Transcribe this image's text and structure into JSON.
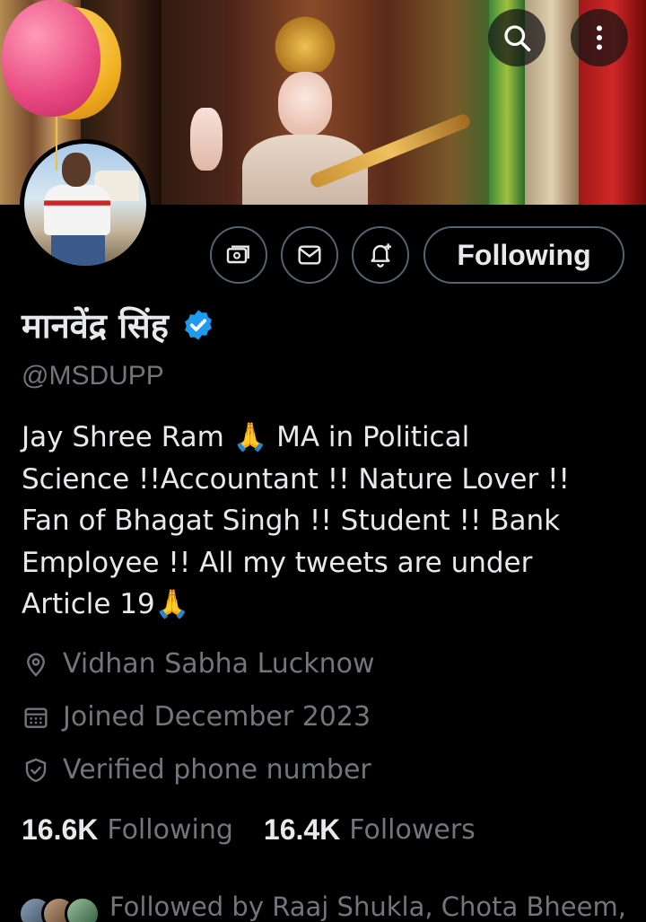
{
  "profile": {
    "name": "मानवेंद्र सिंह",
    "handle": "@MSDUPP",
    "bio": "Jay Shree Ram 🙏 MA in Political\nScience !!Accountant !! Nature Lover !!\nFan of Bhagat Singh !! Student !! Bank\nEmployee !! All my tweets are under\nArticle 19🙏",
    "location": "Vidhan Sabha Lucknow",
    "joined": "Joined December 2023",
    "verification": "Verified phone number"
  },
  "actions": {
    "follow_label": "Following"
  },
  "stats": {
    "following_count": "16.6K",
    "following_label": "Following",
    "followers_count": "16.4K",
    "followers_label": "Followers"
  },
  "followed_by": {
    "text": "Followed by Raaj Shukla, Chota Bheem,"
  },
  "icons": [
    "search-icon",
    "more-vertical-icon",
    "subscriptions-icon",
    "message-icon",
    "notification-bell-icon",
    "verified-badge-icon",
    "location-icon",
    "calendar-icon",
    "shield-check-icon"
  ],
  "colors": {
    "background": "#000000",
    "text_primary": "#e7e9ea",
    "text_secondary": "#71767b",
    "verified_blue": "#1d9bf0",
    "button_border": "#536471"
  }
}
